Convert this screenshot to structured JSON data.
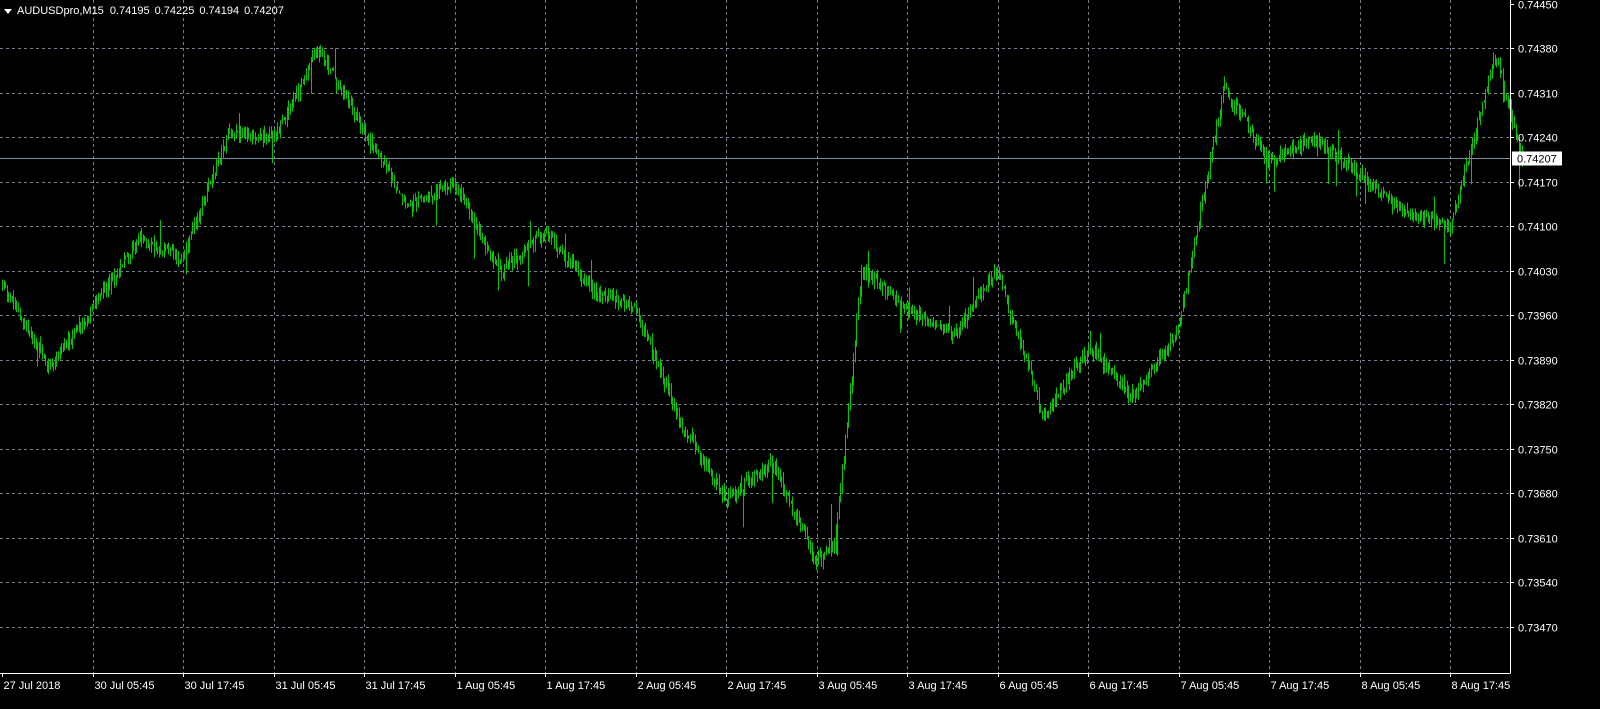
{
  "window": {
    "symbol": "AUDUSDpro,M15",
    "ohlc": [
      "0.74195",
      "0.74225",
      "0.74194",
      "0.74207"
    ]
  },
  "current_price": "0.74207",
  "colors": {
    "background": "#000000",
    "bars": "#00c800",
    "grid": "#8a98aa",
    "axis": "#ffffff",
    "bid_line": "#7d8ea0",
    "price_tag": "#ffffff"
  },
  "chart_data": {
    "type": "bar",
    "symbol": "AUDUSDpro",
    "timeframe": "M15",
    "y_ticks": [
      "0.74450",
      "0.74380",
      "0.74310",
      "0.74240",
      "0.74170",
      "0.74100",
      "0.74030",
      "0.73960",
      "0.73890",
      "0.73820",
      "0.73750",
      "0.73680",
      "0.73610",
      "0.73540",
      "0.73470"
    ],
    "ylim": [
      0.7343,
      0.7445
    ],
    "x_ticks": [
      "27 Jul 2018",
      "30 Jul 05:45",
      "30 Jul 17:45",
      "31 Jul 05:45",
      "31 Jul 17:45",
      "1 Aug 05:45",
      "1 Aug 17:45",
      "2 Aug 05:45",
      "2 Aug 17:45",
      "3 Aug 05:45",
      "3 Aug 17:45",
      "6 Aug 05:45",
      "6 Aug 17:45",
      "7 Aug 05:45",
      "7 Aug 17:45",
      "8 Aug 05:45",
      "8 Aug 17:45"
    ],
    "grid": true,
    "bid_line": 0.74207,
    "closes_by_tick": [
      0.7401,
      0.7395,
      0.7408,
      0.7425,
      0.7438,
      0.7418,
      0.7405,
      0.7403,
      0.7357,
      0.7362,
      0.7361,
      0.7393,
      0.7403,
      0.7391,
      0.7383,
      0.7418,
      0.7424,
      0.7432,
      0.738,
      0.742
    ],
    "series": [
      {
        "x": [
          0,
          0.5,
          1,
          1.5,
          2,
          2.5,
          3,
          3.5,
          4,
          4.5,
          5,
          5.5,
          6,
          6.5,
          7,
          7.5,
          8,
          8.5,
          9,
          9.2,
          9.5,
          10,
          10.5,
          11,
          11.5,
          12,
          12.5,
          13,
          13.5,
          14,
          14.5,
          15,
          15.5,
          16,
          16.5,
          16.8
        ],
        "values": [
          0.7401,
          0.7388,
          0.7397,
          0.7408,
          0.7405,
          0.7425,
          0.7424,
          0.7438,
          0.7425,
          0.7413,
          0.7417,
          0.7403,
          0.7409,
          0.74,
          0.7397,
          0.7379,
          0.7367,
          0.7373,
          0.7357,
          0.736,
          0.7403,
          0.7397,
          0.7393,
          0.7403,
          0.738,
          0.7391,
          0.7383,
          0.7394,
          0.7432,
          0.742,
          0.7424,
          0.7418,
          0.7412,
          0.741,
          0.7437,
          0.742
        ]
      }
    ]
  }
}
